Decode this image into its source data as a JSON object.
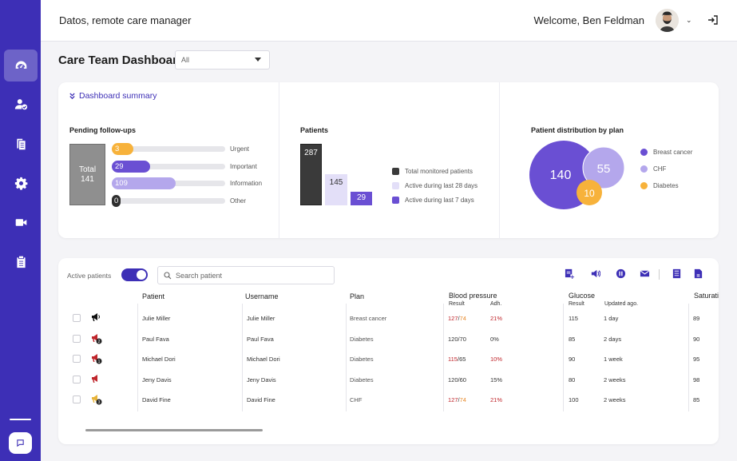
{
  "app": {
    "title": "Datos, remote care manager",
    "welcome": "Welcome, Ben Feldman"
  },
  "sidebar": {
    "items": [
      "dashboard-icon",
      "user-check-icon",
      "documents-icon",
      "gear-icon",
      "video-icon",
      "clipboard-icon"
    ]
  },
  "page": {
    "title": "Care Team Dashboard",
    "filter_value": "All"
  },
  "summary": {
    "link": "Dashboard summary",
    "followups": {
      "title": "Pending follow-ups",
      "total_label": "Total",
      "total": "141",
      "bars": [
        {
          "value": "3",
          "label": "Urgent",
          "color": "#f7b23b",
          "fill": 0.19
        },
        {
          "value": "29",
          "label": "Important",
          "color": "#6a4fd3",
          "fill": 0.34
        },
        {
          "value": "109",
          "label": "Information",
          "color": "#b4a7ec",
          "fill": 0.56
        },
        {
          "value": "0",
          "label": "Other",
          "color": "#2f2f2f",
          "fill": 0.08
        }
      ]
    },
    "patients": {
      "title": "Patients",
      "bars": [
        {
          "value": "287",
          "label": "Total monitored patients",
          "color": "#3a3a3a"
        },
        {
          "value": "145",
          "label": "Active during last 28 days",
          "color": "#e3dff8"
        },
        {
          "value": "29",
          "label": "Active during last 7 days",
          "color": "#6a4fd3"
        }
      ]
    },
    "distribution": {
      "title": "Patient distribution by plan",
      "items": [
        {
          "value": "140",
          "label": "Breast cancer",
          "color": "#6a4fd3"
        },
        {
          "value": "55",
          "label": "CHF",
          "color": "#b4a7ec"
        },
        {
          "value": "10",
          "label": "Diabetes",
          "color": "#f7b23b"
        }
      ]
    }
  },
  "table": {
    "active_label": "Active patients",
    "search_placeholder": "Search patient",
    "headers": {
      "patient": "Patient",
      "username": "Username",
      "plan": "Plan",
      "bp": "Blood pressure",
      "bp_result": "Result",
      "bp_adh": "Adh.",
      "glucose": "Glucose",
      "glu_result": "Result",
      "glu_updated": "Updated ago.",
      "saturation": "Saturati"
    },
    "rows": [
      {
        "patient": "Julie Miller",
        "username": "Julie Miller",
        "plan": "Breast cancer",
        "bp_sys": "127",
        "bp_sep": "/",
        "bp_dia": "74",
        "bp_sys_class": "red",
        "bp_dia_class": "org",
        "adh": "21%",
        "adh_class": "red",
        "glu": "115",
        "updated": "1 day",
        "sat": "89",
        "alert": "megaphone",
        "badge": ""
      },
      {
        "patient": "Paul Fava",
        "username": "Paul Fava",
        "plan": "Diabetes",
        "bp_sys": "120",
        "bp_sep": "/",
        "bp_dia": "70",
        "bp_sys_class": "",
        "bp_dia_class": "",
        "adh": "0%",
        "adh_class": "",
        "glu": "85",
        "updated": "2 days",
        "sat": "90",
        "alert": "red",
        "badge": "2"
      },
      {
        "patient": "Michael Dori",
        "username": "Michael Dori",
        "plan": "Diabetes",
        "bp_sys": "115",
        "bp_sep": "/",
        "bp_dia": "65",
        "bp_sys_class": "red",
        "bp_dia_class": "",
        "adh": "10%",
        "adh_class": "red",
        "glu": "90",
        "updated": "1 week",
        "sat": "95",
        "alert": "red",
        "badge": "1"
      },
      {
        "patient": "Jeny Davis",
        "username": "Jeny Davis",
        "plan": "Diabetes",
        "bp_sys": "120",
        "bp_sep": "/",
        "bp_dia": "60",
        "bp_sys_class": "",
        "bp_dia_class": "",
        "adh": "15%",
        "adh_class": "",
        "glu": "80",
        "updated": "2 weeks",
        "sat": "98",
        "alert": "red",
        "badge": ""
      },
      {
        "patient": "David Fine",
        "username": "David Fine",
        "plan": "CHF",
        "bp_sys": "127",
        "bp_sep": "/",
        "bp_dia": "74",
        "bp_sys_class": "red",
        "bp_dia_class": "org",
        "adh": "21%",
        "adh_class": "red",
        "glu": "100",
        "updated": "2 weeks",
        "sat": "85",
        "alert": "yellow",
        "badge": "3"
      }
    ]
  },
  "colors": {
    "brand": "#3d2fb6",
    "urgent": "#f7b23b",
    "alert_red": "#c0262c"
  }
}
